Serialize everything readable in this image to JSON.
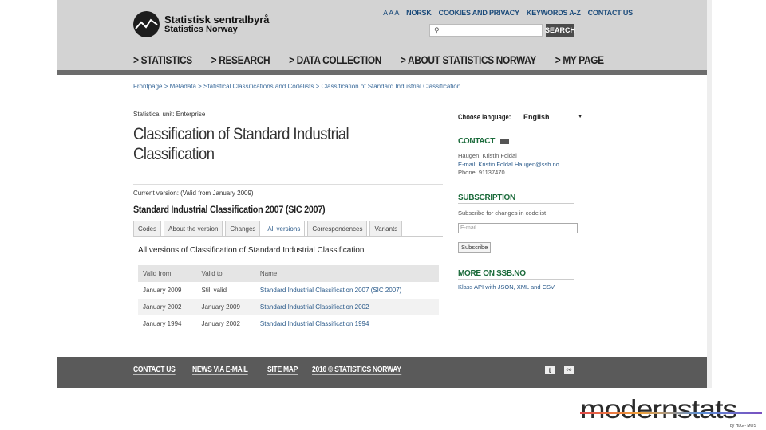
{
  "header": {
    "logo_title": "Statistisk sentralbyrå",
    "logo_sub": "Statistics Norway",
    "text_size": "A A A",
    "top_links": [
      "NORSK",
      "COOKIES AND PRIVACY",
      "KEYWORDS A-Z",
      "CONTACT US"
    ],
    "search_button": "SEARCH",
    "nav": [
      "> STATISTICS",
      "> RESEARCH",
      "> DATA COLLECTION",
      "> ABOUT STATISTICS NORWAY",
      "> MY PAGE"
    ]
  },
  "breadcrumb": "Frontpage > Metadata > Statistical Classifications and Codelists > Classification of Standard Industrial Classification",
  "main": {
    "statistical_unit": "Statistical unit: Enterprise",
    "title": "Classification of Standard Industrial Classification",
    "current_version": "Current version: (Valid from January 2009)",
    "version_name": "Standard Industrial Classification 2007 (SIC 2007)",
    "tabs": [
      "Codes",
      "About the version",
      "Changes",
      "All versions",
      "Correspondences",
      "Variants"
    ],
    "active_tab": "All versions",
    "table_title": "All versions of Classification of Standard Industrial Classification",
    "table_headers": [
      "Valid from",
      "Valid to",
      "Name"
    ],
    "rows": [
      {
        "from": "January 2009",
        "to": "Still valid",
        "name": "Standard Industrial Classification 2007 (SIC 2007)"
      },
      {
        "from": "January 2002",
        "to": "January 2009",
        "name": "Standard Industrial Classification 2002"
      },
      {
        "from": "January 1994",
        "to": "January 2002",
        "name": "Standard Industrial Classification 1994"
      }
    ]
  },
  "sidebar": {
    "language_label": "Choose language:",
    "language_value": "English",
    "contact_head": "CONTACT",
    "contact_name": "Haugen, Kristin Foldal",
    "contact_email": "E-mail: Kristin.Foldal.Haugen@ssb.no",
    "contact_phone": "Phone: 91137470",
    "subscription_head": "SUBSCRIPTION",
    "subscription_text": "Subscribe for changes in codelist",
    "email_placeholder": "E-mail",
    "subscribe_button": "Subscribe",
    "more_head": "MORE ON SSB.NO",
    "more_text": "Klass API with JSON, XML and CSV"
  },
  "footer": {
    "links": [
      "CONTACT US",
      "NEWS VIA E-MAIL",
      "SITE MAP",
      "2016 © STATISTICS NORWAY"
    ]
  },
  "branding": {
    "word": "modernstats",
    "sub": "by HLG - MOS"
  },
  "colors": {
    "header_bg": "#d3d3d3",
    "footer_bg": "#5a5a5a",
    "link": "#2a5a8a",
    "sidebar_head": "#1a6a3a"
  }
}
